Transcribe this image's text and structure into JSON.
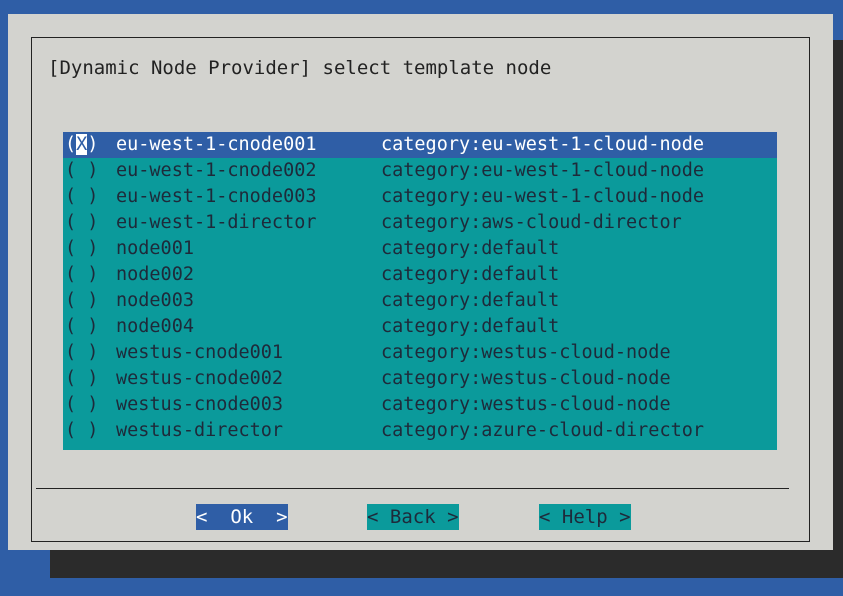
{
  "dialog": {
    "title": "[Dynamic Node Provider] select template node"
  },
  "nodes": [
    {
      "radio_open": "(",
      "radio_mark": "X",
      "radio_close": ")",
      "name": "eu-west-1-cnode001",
      "category": "category:eu-west-1-cloud-node",
      "selected": true
    },
    {
      "radio_open": "(",
      "radio_mark": " ",
      "radio_close": ")",
      "name": "eu-west-1-cnode002",
      "category": "category:eu-west-1-cloud-node",
      "selected": false
    },
    {
      "radio_open": "(",
      "radio_mark": " ",
      "radio_close": ")",
      "name": "eu-west-1-cnode003",
      "category": "category:eu-west-1-cloud-node",
      "selected": false
    },
    {
      "radio_open": "(",
      "radio_mark": " ",
      "radio_close": ")",
      "name": "eu-west-1-director",
      "category": "category:aws-cloud-director",
      "selected": false
    },
    {
      "radio_open": "(",
      "radio_mark": " ",
      "radio_close": ")",
      "name": "node001",
      "category": "category:default",
      "selected": false
    },
    {
      "radio_open": "(",
      "radio_mark": " ",
      "radio_close": ")",
      "name": "node002",
      "category": "category:default",
      "selected": false
    },
    {
      "radio_open": "(",
      "radio_mark": " ",
      "radio_close": ")",
      "name": "node003",
      "category": "category:default",
      "selected": false
    },
    {
      "radio_open": "(",
      "radio_mark": " ",
      "radio_close": ")",
      "name": "node004",
      "category": "category:default",
      "selected": false
    },
    {
      "radio_open": "(",
      "radio_mark": " ",
      "radio_close": ")",
      "name": "westus-cnode001",
      "category": "category:westus-cloud-node",
      "selected": false
    },
    {
      "radio_open": "(",
      "radio_mark": " ",
      "radio_close": ")",
      "name": "westus-cnode002",
      "category": "category:westus-cloud-node",
      "selected": false
    },
    {
      "radio_open": "(",
      "radio_mark": " ",
      "radio_close": ")",
      "name": "westus-cnode003",
      "category": "category:westus-cloud-node",
      "selected": false
    },
    {
      "radio_open": "(",
      "radio_mark": " ",
      "radio_close": ")",
      "name": "westus-director",
      "category": "category:azure-cloud-director",
      "selected": false
    }
  ],
  "buttons": {
    "ok": "<  Ok  >",
    "back": "< Back >",
    "help": "< Help >"
  },
  "colors": {
    "background": "#2f5ea6",
    "dialog": "#d3d3cf",
    "list": "#0b9a9b",
    "selected_row": "#2f5ea6",
    "shadow": "#2b2b2b"
  }
}
